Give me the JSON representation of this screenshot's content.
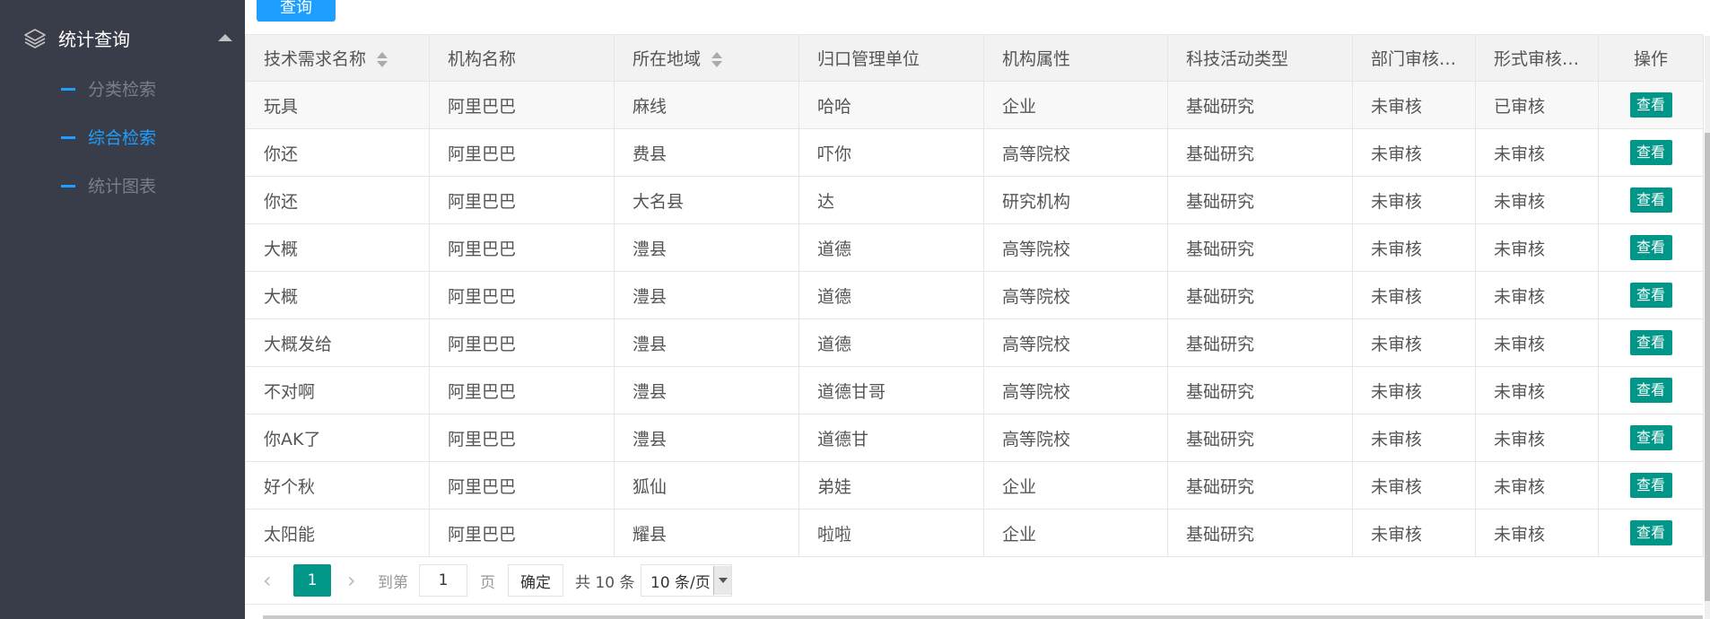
{
  "sidebar": {
    "title": "统计查询",
    "items": [
      {
        "label": "分类检索",
        "active": false
      },
      {
        "label": "综合检索",
        "active": true
      },
      {
        "label": "统计图表",
        "active": false
      }
    ]
  },
  "toolbar": {
    "query_label": "查询"
  },
  "table": {
    "headers": [
      "技术需求名称",
      "机构名称",
      "所在地域",
      "归口管理单位",
      "机构属性",
      "科技活动类型",
      "部门审核…",
      "形式审核…",
      "操作"
    ],
    "rows": [
      [
        "玩具",
        "阿里巴巴",
        "麻线",
        "哈哈",
        "企业",
        "基础研究",
        "未审核",
        "已审核",
        "查看"
      ],
      [
        "你还",
        "阿里巴巴",
        "费县",
        "吓你",
        "高等院校",
        "基础研究",
        "未审核",
        "未审核",
        "查看"
      ],
      [
        "你还",
        "阿里巴巴",
        "大名县",
        "达",
        "研究机构",
        "基础研究",
        "未审核",
        "未审核",
        "查看"
      ],
      [
        "大概",
        "阿里巴巴",
        "澧县",
        "道德",
        "高等院校",
        "基础研究",
        "未审核",
        "未审核",
        "查看"
      ],
      [
        "大概",
        "阿里巴巴",
        "澧县",
        "道德",
        "高等院校",
        "基础研究",
        "未审核",
        "未审核",
        "查看"
      ],
      [
        "大概发给",
        "阿里巴巴",
        "澧县",
        "道德",
        "高等院校",
        "基础研究",
        "未审核",
        "未审核",
        "查看"
      ],
      [
        "不对啊",
        "阿里巴巴",
        "澧县",
        "道德甘哥",
        "高等院校",
        "基础研究",
        "未审核",
        "未审核",
        "查看"
      ],
      [
        "你AK了",
        "阿里巴巴",
        "澧县",
        "道德甘",
        "高等院校",
        "基础研究",
        "未审核",
        "未审核",
        "查看"
      ],
      [
        "好个秋",
        "阿里巴巴",
        "狐仙",
        "弟娃",
        "企业",
        "基础研究",
        "未审核",
        "未审核",
        "查看"
      ],
      [
        "太阳能",
        "阿里巴巴",
        "耀县",
        "啦啦",
        "企业",
        "基础研究",
        "未审核",
        "未审核",
        "查看"
      ]
    ]
  },
  "pager": {
    "prev": "‹",
    "current": "1",
    "next": "›",
    "goto_label": "到第",
    "goto_value": "1",
    "page_label": "页",
    "confirm_label": "确定",
    "total_label": "共 10 条",
    "page_size": "10 条/页"
  },
  "icons": {
    "menu": "layers-icon",
    "collapse": "caret-up-icon",
    "sort": "sort-icon",
    "dropdown": "chevron-down-icon"
  },
  "colors": {
    "sidebar_bg": "#393d49",
    "accent": "#1e9fff",
    "view_button": "#009688",
    "current_page": "#009688"
  }
}
